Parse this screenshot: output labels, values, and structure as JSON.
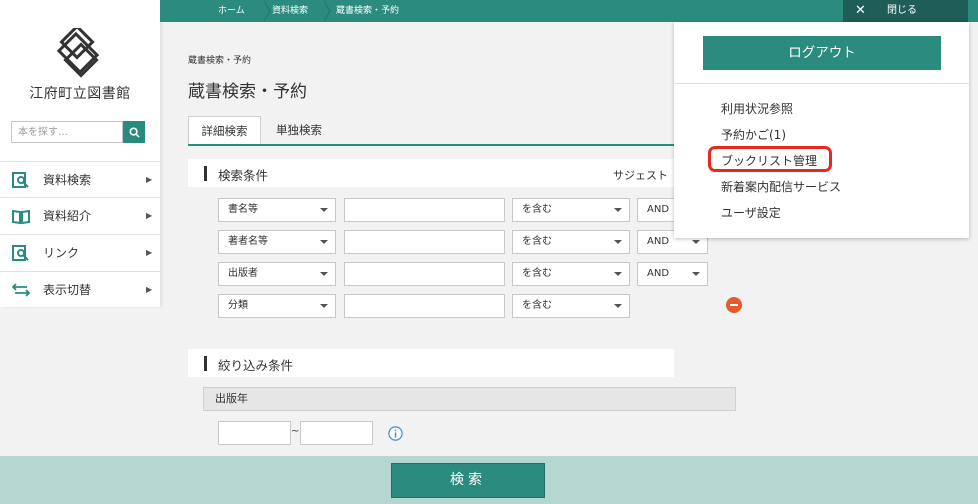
{
  "sidebar": {
    "library_name": "江府町立図書館",
    "search_placeholder": "本を探す…",
    "items": [
      {
        "label": "資料検索",
        "icon": "book-search-icon"
      },
      {
        "label": "資料紹介",
        "icon": "open-book-icon"
      },
      {
        "label": "リンク",
        "icon": "link-search-icon"
      },
      {
        "label": "表示切替",
        "icon": "swap-arrows-icon"
      }
    ]
  },
  "topbar": {
    "breadcrumbs": [
      "ホーム",
      "資料検索",
      "蔵書検索・予約"
    ],
    "close_label": "閉じる"
  },
  "main": {
    "breadcrumb": "蔵書検索・予約",
    "title": "蔵書検索・予約",
    "tabs": [
      "詳細検索",
      "単独検索"
    ],
    "conditions_title": "検索条件",
    "suggest_label": "サジェスト",
    "rows": [
      {
        "field": "書名等",
        "match": "を含む",
        "op": "AND"
      },
      {
        "field": "著者名等",
        "match": "を含む",
        "op": "AND"
      },
      {
        "field": "出版者",
        "match": "を含む",
        "op": "AND"
      },
      {
        "field": "分類",
        "match": "を含む",
        "op": ""
      }
    ],
    "filter_title": "絞り込み条件",
    "pub_year_label": "出版年",
    "tilde": "~",
    "search_button": "検索"
  },
  "menu": {
    "logout_label": "ログアウト",
    "items": [
      "利用状況参照",
      "予約かご(1)",
      "ブックリスト管理",
      "新着案内配信サービス",
      "ユーザ設定"
    ]
  },
  "colors": {
    "accent": "#2b8b7f",
    "highlight": "#e8281c",
    "remove": "#e35b2e"
  }
}
